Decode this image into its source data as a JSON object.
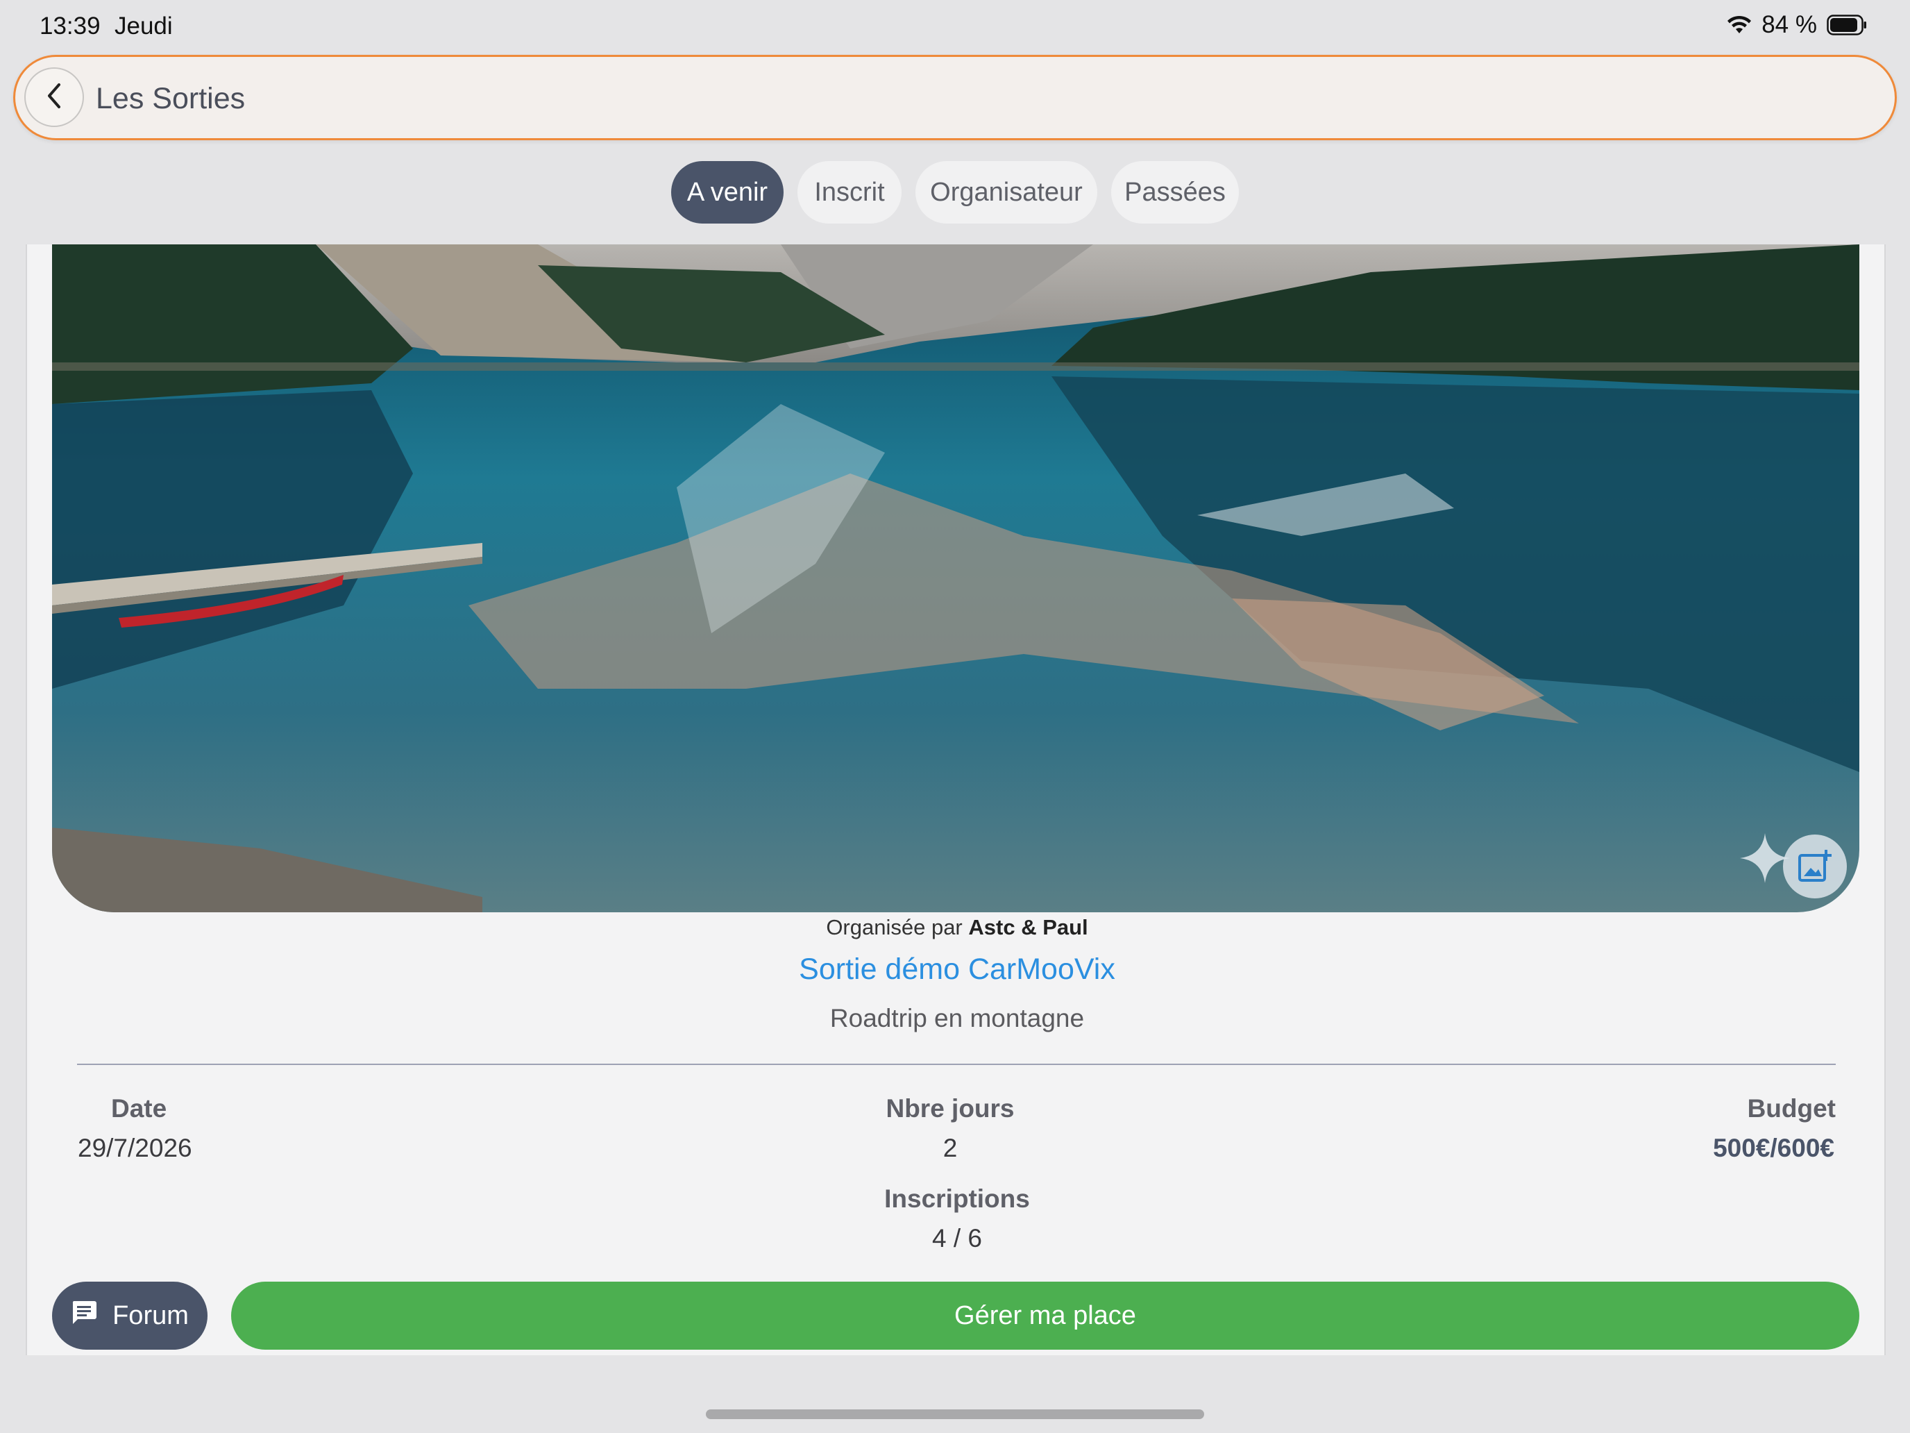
{
  "status_bar": {
    "time": "13:39",
    "day": "Jeudi",
    "battery_percent": "84 %",
    "icons": [
      "wifi-icon",
      "battery-icon"
    ]
  },
  "app_bar": {
    "title": "Les Sorties",
    "back_icon": "chevron-left-icon",
    "accent_color": "#ef8a3a"
  },
  "tabs": [
    {
      "label": "A venir",
      "active": true
    },
    {
      "label": "Inscrit",
      "active": false
    },
    {
      "label": "Organisateur",
      "active": false
    },
    {
      "label": "Passées",
      "active": false
    }
  ],
  "event": {
    "organizer_prefix": "Organisée par",
    "organizer_name": "Astc & Paul",
    "title": "Sortie démo CarMooVix",
    "subtitle": "Roadtrip en montagne",
    "image_icons": [
      "sparkle-icon",
      "add-photo-icon"
    ],
    "stats": {
      "date_label": "Date",
      "date_value": "29/7/2026",
      "days_label": "Nbre jours",
      "days_value": "2",
      "budget_label": "Budget",
      "budget_value": "500€/600€",
      "registrations_label": "Inscriptions",
      "registrations_value": "4 / 6"
    }
  },
  "actions": {
    "forum_label": "Forum",
    "forum_icon": "chat-icon",
    "manage_label": "Gérer ma place",
    "manage_color": "#4caf50",
    "forum_color": "#4a5469"
  }
}
